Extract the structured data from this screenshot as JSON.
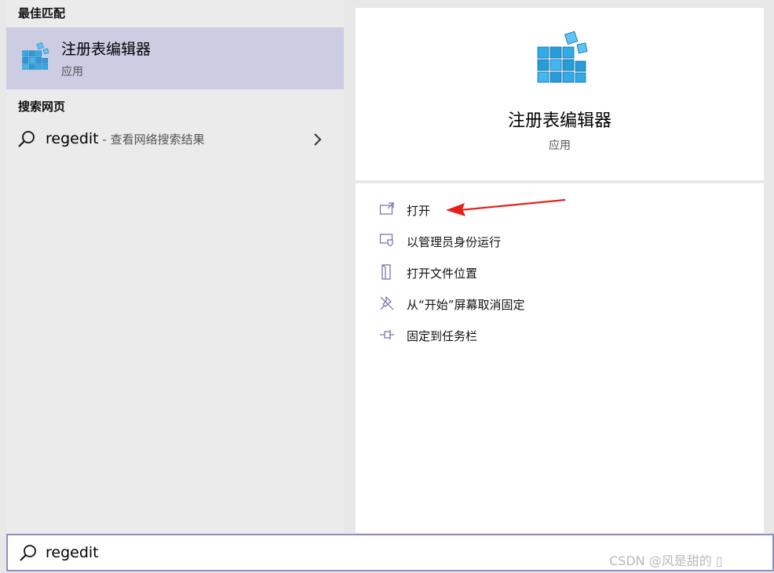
{
  "results": {
    "best_match_header": "最佳匹配",
    "best_match": {
      "title": "注册表编辑器",
      "subtitle": "应用",
      "icon": "registry-cubes-icon"
    },
    "web_header": "搜索网页",
    "web_result": {
      "query": "regedit",
      "suffix": " - 查看网络搜索结果",
      "icon": "search-icon",
      "chevron": "chevron-right-icon"
    }
  },
  "detail": {
    "title": "注册表编辑器",
    "subtitle": "应用",
    "icon": "registry-cubes-icon",
    "actions": [
      {
        "label": "打开",
        "icon": "open-window-icon"
      },
      {
        "label": "以管理员身份运行",
        "icon": "shield-icon"
      },
      {
        "label": "打开文件位置",
        "icon": "folder-location-icon"
      },
      {
        "label": "从“开始”屏幕取消固定",
        "icon": "unpin-icon"
      },
      {
        "label": "固定到任务栏",
        "icon": "pin-icon"
      }
    ]
  },
  "search": {
    "value": "regedit",
    "icon": "search-icon"
  },
  "watermark": "CSDN @风是甜的 ▯",
  "colors": {
    "selection": "#cccce3",
    "accent": "#8d8dc7",
    "arrow": "#e8211d",
    "icon_blue": "#2ea3e3"
  }
}
